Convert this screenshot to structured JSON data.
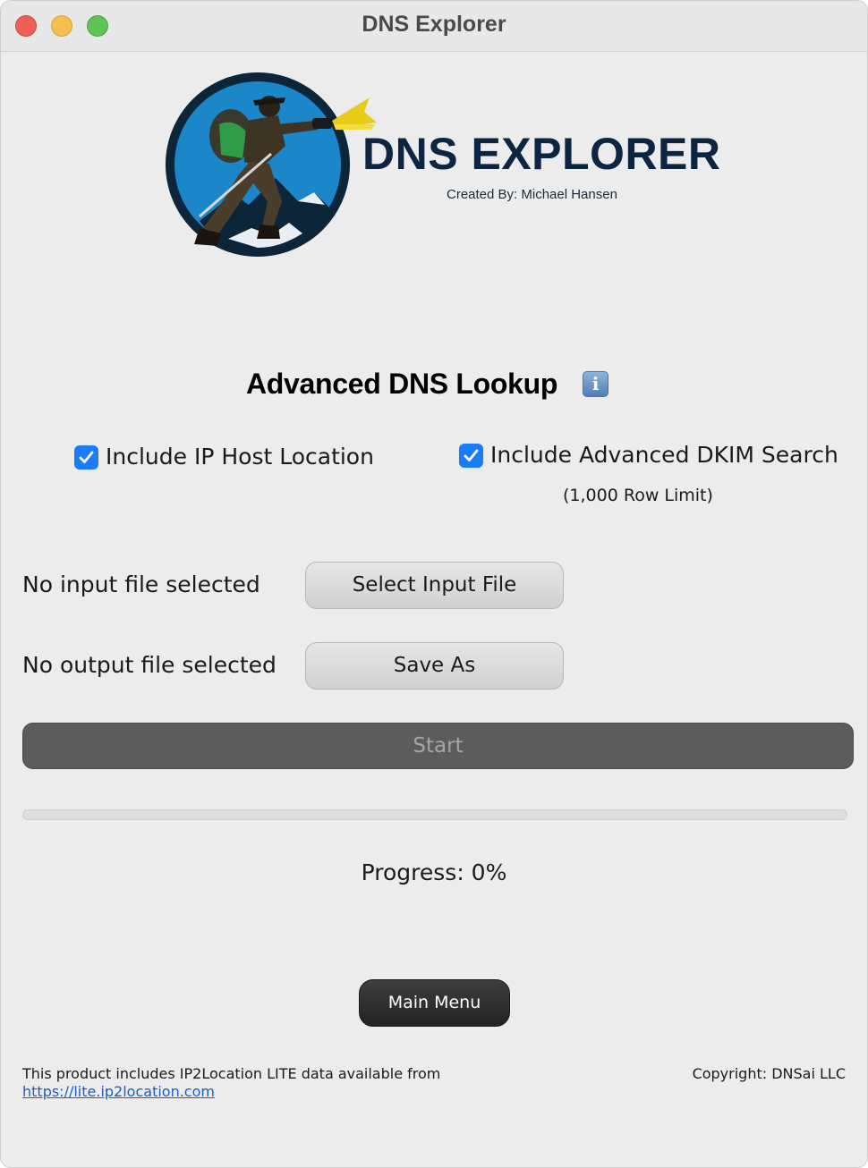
{
  "window": {
    "title": "DNS Explorer"
  },
  "logo": {
    "title": "DNS EXPLORER",
    "subtitle": "Created By: Michael Hansen"
  },
  "section": {
    "title": "Advanced DNS Lookup",
    "info_icon": "info-icon",
    "info_glyph": "i"
  },
  "options": {
    "ip_location": {
      "label": "Include IP Host Location",
      "checked": true
    },
    "dkim": {
      "label": "Include Advanced DKIM Search",
      "note": "(1,000 Row Limit)",
      "checked": true
    }
  },
  "files": {
    "input_status": "No input file selected",
    "input_button": "Select Input File",
    "output_status": "No output file selected",
    "output_button": "Save As"
  },
  "actions": {
    "start": "Start",
    "main_menu": "Main Menu"
  },
  "progress": {
    "text": "Progress: 0%",
    "value": 0
  },
  "footer": {
    "notice": "This product includes IP2Location LITE data available from",
    "link": "https://lite.ip2location.com",
    "copyright": "Copyright: DNSai LLC"
  },
  "colors": {
    "accent": "#1a7cf6",
    "window_bg": "#ececec",
    "start_bg": "#5c5c5c",
    "logo_text": "#0c2540"
  }
}
